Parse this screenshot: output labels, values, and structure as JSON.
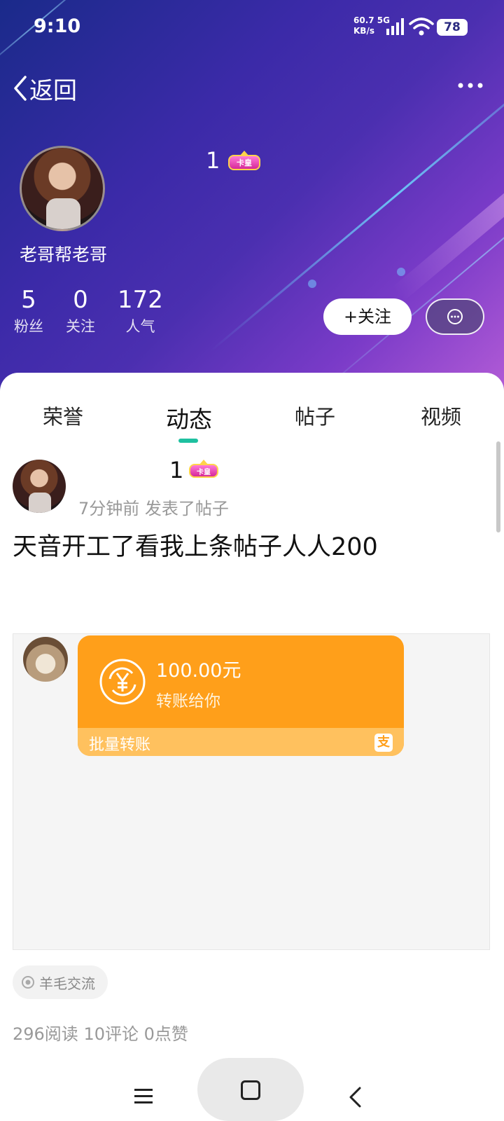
{
  "status_bar": {
    "time": "9:10",
    "net_speed_value": "60.7",
    "net_speed_unit": "KB/s",
    "network_type": "5G",
    "battery": "78"
  },
  "nav": {
    "back_label": "返回"
  },
  "profile": {
    "name": "老哥帮老哥",
    "level": "1",
    "badge_text": "卡皇",
    "stats": [
      {
        "value": "5",
        "label": "粉丝"
      },
      {
        "value": "0",
        "label": "关注"
      },
      {
        "value": "172",
        "label": "人气"
      }
    ],
    "follow_label": "+关注"
  },
  "tabs": [
    {
      "label": "荣誉",
      "active": false
    },
    {
      "label": "动态",
      "active": true
    },
    {
      "label": "帖子",
      "active": false
    },
    {
      "label": "视频",
      "active": false
    }
  ],
  "post": {
    "level": "1",
    "badge_text": "卡皇",
    "time": "7分钟前",
    "action": "发表了帖子",
    "text": "天音开工了看我上条帖子人人200",
    "image": {
      "amount": "100.00元",
      "sub_text": "转账给你",
      "batch_label": "批量转账",
      "alipay_glyph": "支"
    },
    "topic": "羊毛交流",
    "reads": "296阅读",
    "comments": "10评论",
    "likes": "0点赞"
  },
  "colors": {
    "accent": "#1ec0a0",
    "transfer_orange": "#ff9f1a",
    "header_start": "#1a2a8a",
    "header_end": "#b25bd6"
  },
  "icons": [
    "signal-icon",
    "wifi-icon",
    "chevron-left-icon",
    "more-icon",
    "chat-icon",
    "yuan-icon",
    "alipay-icon",
    "topic-icon",
    "menu-icon",
    "home-icon",
    "back-icon"
  ]
}
